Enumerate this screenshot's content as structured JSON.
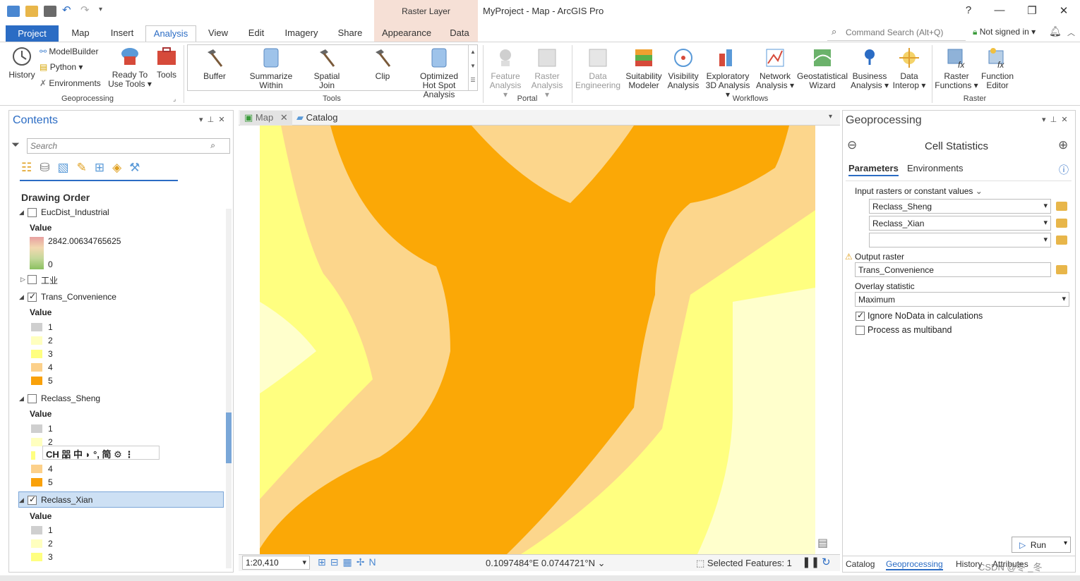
{
  "window": {
    "title": "MyProject - Map - ArcGIS Pro",
    "context_tab": "Raster Layer",
    "help": "?"
  },
  "tabs": [
    "Project",
    "Map",
    "Insert",
    "Analysis",
    "View",
    "Edit",
    "Imagery",
    "Share",
    "Appearance",
    "Data"
  ],
  "active_tab": "Analysis",
  "command_search": "Command Search (Alt+Q)",
  "signin": "Not signed in",
  "ribbon": {
    "geoprocessing": {
      "history": "History",
      "modelbuilder": "ModelBuilder",
      "python": "Python",
      "environments": "Environments",
      "ready": "Ready To Use Tools",
      "tools": "Tools",
      "label": "Geoprocessing"
    },
    "tools": {
      "buffer": "Buffer",
      "summarize": "Summarize Within",
      "spatial_join": "Spatial Join",
      "clip": "Clip",
      "hotspot": "Optimized Hot Spot Analysis",
      "label": "Tools"
    },
    "portal": {
      "feature": "Feature Analysis",
      "raster": "Raster Analysis",
      "label": "Portal"
    },
    "workflows": {
      "data_eng": "Data Engineering",
      "suitability": "Suitability Modeler",
      "visibility": "Visibility Analysis",
      "exploratory": "Exploratory 3D Analysis",
      "network": "Network Analysis",
      "geostat": "Geostatistical Wizard",
      "business": "Business Analysis",
      "interop": "Data Interop",
      "label": "Workflows"
    },
    "raster": {
      "functions": "Raster Functions",
      "editor": "Function Editor",
      "label": "Raster"
    }
  },
  "contents": {
    "title": "Contents",
    "search_placeholder": "Search",
    "drawing_order": "Drawing Order",
    "value_label": "Value",
    "layers": [
      {
        "name": "EucDist_Industrial",
        "max": "2842.00634765625",
        "min": "0"
      },
      {
        "name": "工业"
      },
      {
        "name": "Trans_Convenience",
        "classes": [
          "1",
          "2",
          "3",
          "4",
          "5"
        ]
      },
      {
        "name": "Reclass_Sheng",
        "classes": [
          "1",
          "2",
          "3",
          "4",
          "5"
        ]
      },
      {
        "name": "Reclass_Xian",
        "classes": [
          "1",
          "2",
          "3"
        ]
      }
    ],
    "ime_bar": "CH 㗊 中 ◗ °, 简 ⚙ ⋮"
  },
  "map": {
    "tabs": [
      "Map",
      "Catalog"
    ],
    "scale": "1:20,410",
    "coords": "0.1097484°E 0.0744721°N",
    "selected": "Selected Features: 1",
    "colors": {
      "c1": "#ffffcc",
      "c2": "#ffff80",
      "c3": "#fcd68c",
      "c4": "#fcd68c",
      "c5": "#fba806"
    }
  },
  "geoprocessing": {
    "title": "Geoprocessing",
    "tool": "Cell Statistics",
    "tab_params": "Parameters",
    "tab_env": "Environments",
    "input_label": "Input rasters or constant values",
    "inputs": [
      "Reclass_Sheng",
      "Reclass_Xian",
      ""
    ],
    "output_label": "Output raster",
    "output_value": "Trans_Convenience",
    "overlay_label": "Overlay statistic",
    "overlay_value": "Maximum",
    "ignore_nodata": "Ignore NoData in calculations",
    "multiband": "Process as multiband",
    "run": "Run",
    "bottom_tabs": [
      "Catalog",
      "Geoprocessing",
      "History",
      "Attributes"
    ]
  },
  "watermark": "CSDN @冬 _冬"
}
